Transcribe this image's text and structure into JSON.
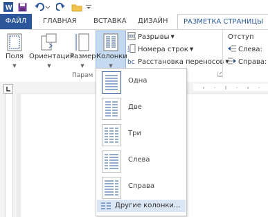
{
  "tabs": {
    "file": "ФАЙЛ",
    "home": "ГЛАВНАЯ",
    "insert": "ВСТАВКА",
    "design": "ДИЗАЙН",
    "layout": "РАЗМЕТКА СТРАНИЦЫ"
  },
  "ribbon": {
    "margins": "Поля",
    "orientation": "Ориентация",
    "size": "Размер",
    "columns": "Колонки",
    "breaks": "Разрывы",
    "line_numbers": "Номера строк",
    "hyphenation": "Расстановка переносов",
    "group_label": "Парам",
    "indent_header": "Отступ",
    "indent_left": "Слева:",
    "indent_right": "Справа:"
  },
  "columns_menu": {
    "items": [
      "Одна",
      "Две",
      "Три",
      "Слева",
      "Справа"
    ],
    "more": "Другие колонки..."
  },
  "colors": {
    "accent": "#2b579a",
    "word_blue": "#2b579a",
    "highlight": "#dbe6f4"
  }
}
